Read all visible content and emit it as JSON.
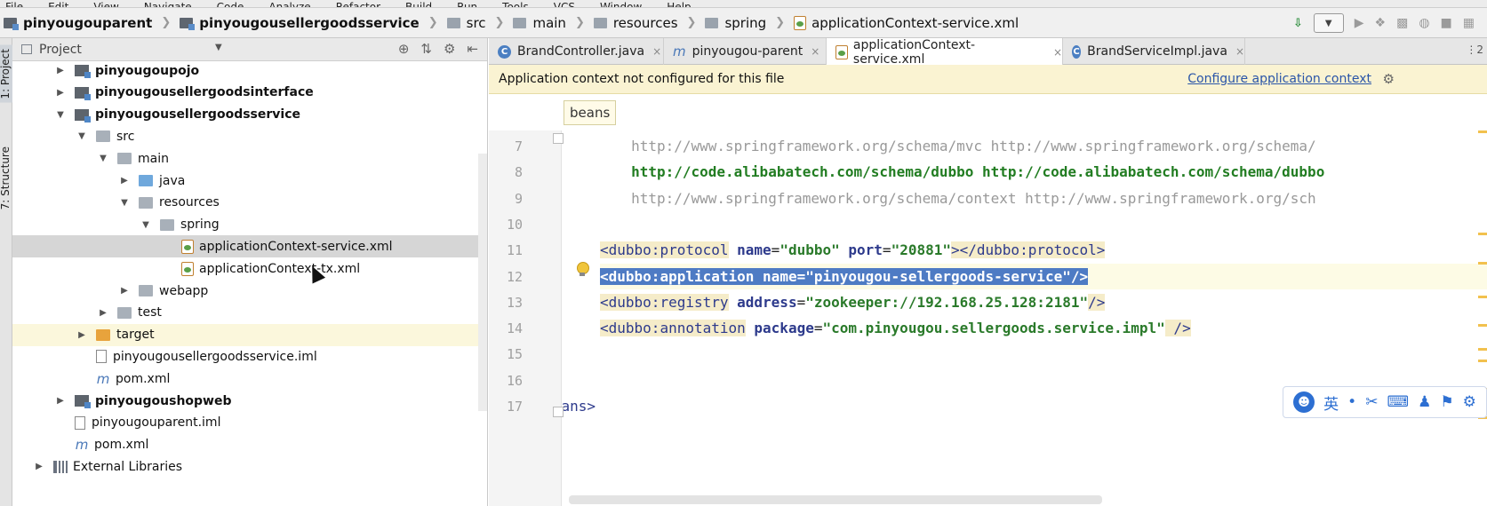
{
  "menubar": [
    "File",
    "Edit",
    "View",
    "Navigate",
    "Code",
    "Analyze",
    "Refactor",
    "Build",
    "Run",
    "Tools",
    "VCS",
    "Window",
    "Help"
  ],
  "breadcrumb": [
    {
      "label": "pinyougouparent",
      "kind": "module",
      "bold": true
    },
    {
      "label": "pinyougousellergoodsservice",
      "kind": "module",
      "bold": true
    },
    {
      "label": "src",
      "kind": "folder",
      "bold": false
    },
    {
      "label": "main",
      "kind": "folder",
      "bold": false
    },
    {
      "label": "resources",
      "kind": "folder",
      "bold": false
    },
    {
      "label": "spring",
      "kind": "folder",
      "bold": false
    },
    {
      "label": "applicationContext-service.xml",
      "kind": "xml",
      "bold": false
    }
  ],
  "left_strip": {
    "project_tab": "1: Project",
    "structure_tab": "7: Structure"
  },
  "project_panel": {
    "title": "Project"
  },
  "tree": [
    {
      "label": "pinyougoupojo",
      "level": 1,
      "arrow": "▶",
      "icon": "module",
      "bold": true
    },
    {
      "label": "pinyougousellergoodsinterface",
      "level": 1,
      "arrow": "▶",
      "icon": "module",
      "bold": true
    },
    {
      "label": "pinyougousellergoodsservice",
      "level": 1,
      "arrow": "▼",
      "icon": "module",
      "bold": true
    },
    {
      "label": "src",
      "level": 2,
      "arrow": "▼",
      "icon": "folder",
      "bold": false
    },
    {
      "label": "main",
      "level": 3,
      "arrow": "▼",
      "icon": "folder",
      "bold": false
    },
    {
      "label": "java",
      "level": 4,
      "arrow": "▶",
      "icon": "folder-blue",
      "bold": false
    },
    {
      "label": "resources",
      "level": 4,
      "arrow": "▼",
      "icon": "folder",
      "bold": false
    },
    {
      "label": "spring",
      "level": 5,
      "arrow": "▼",
      "icon": "folder",
      "bold": false
    },
    {
      "label": "applicationContext-service.xml",
      "level": 6,
      "arrow": "",
      "icon": "xml",
      "bold": false,
      "selected": true
    },
    {
      "label": "applicationContext-tx.xml",
      "level": 6,
      "arrow": "",
      "icon": "xml",
      "bold": false
    },
    {
      "label": "webapp",
      "level": 4,
      "arrow": "▶",
      "icon": "folder",
      "bold": false
    },
    {
      "label": "test",
      "level": 3,
      "arrow": "▶",
      "icon": "folder",
      "bold": false
    },
    {
      "label": "target",
      "level": 2,
      "arrow": "▶",
      "icon": "folder-orange",
      "bold": false,
      "excluded": true
    },
    {
      "label": "pinyougousellergoodsservice.iml",
      "level": 2,
      "arrow": "",
      "icon": "file",
      "bold": false
    },
    {
      "label": "pom.xml",
      "level": 2,
      "arrow": "",
      "icon": "maven",
      "bold": false
    },
    {
      "label": "pinyougoushopweb",
      "level": 1,
      "arrow": "▶",
      "icon": "module",
      "bold": true
    },
    {
      "label": "pinyougouparent.iml",
      "level": 1,
      "arrow": "",
      "icon": "file",
      "bold": false
    },
    {
      "label": "pom.xml",
      "level": 1,
      "arrow": "",
      "icon": "maven",
      "bold": false
    },
    {
      "label": "External Libraries",
      "level": 0,
      "arrow": "▶",
      "icon": "lib",
      "bold": false
    }
  ],
  "tabs": [
    {
      "label": "BrandController.java",
      "icon": "class",
      "active": false
    },
    {
      "label": "pinyougou-parent",
      "icon": "maven",
      "active": false
    },
    {
      "label": "applicationContext-service.xml",
      "icon": "xml",
      "active": true
    },
    {
      "label": "BrandServiceImpl.java",
      "icon": "class",
      "active": false
    }
  ],
  "tab_overflow": "⋮2",
  "banner": {
    "message": "Application context not configured for this file",
    "action": "Configure application context"
  },
  "breadcrumb_tag": "beans",
  "code_lines": [
    {
      "num": "7",
      "kind": "url",
      "text": "        http://www.springframework.org/schema/mvc http://www.springframework.org/schema/"
    },
    {
      "num": "8",
      "kind": "url-green",
      "text": "        http://code.alibabatech.com/schema/dubbo http://code.alibabatech.com/schema/dubbo"
    },
    {
      "num": "9",
      "kind": "url",
      "text": "        http://www.springframework.org/schema/context http://www.springframework.org/sch"
    },
    {
      "num": "10",
      "kind": "blank",
      "text": ""
    },
    {
      "num": "11",
      "kind": "tag",
      "tag": "dubbo:protocol",
      "attrs": [
        {
          "n": "name",
          "v": "\"dubbo\""
        },
        {
          "n": "port",
          "v": "\"20881\""
        }
      ],
      "close": "></dubbo:protocol>"
    },
    {
      "num": "12",
      "kind": "tag-selected",
      "tag": "dubbo:application",
      "attrs": [
        {
          "n": "name",
          "v": "\"pinyougou-sellergoods-service\""
        }
      ],
      "close": "/>"
    },
    {
      "num": "13",
      "kind": "tag",
      "tag": "dubbo:registry",
      "attrs": [
        {
          "n": "address",
          "v": "\"zookeeper://192.168.25.128:2181\""
        }
      ],
      "close": "/>"
    },
    {
      "num": "14",
      "kind": "tag",
      "tag": "dubbo:annotation",
      "attrs": [
        {
          "n": "package",
          "v": "\"com.pinyougou.sellergoods.service.impl\""
        }
      ],
      "close": " />"
    },
    {
      "num": "15",
      "kind": "blank",
      "text": ""
    },
    {
      "num": "16",
      "kind": "blank",
      "text": ""
    },
    {
      "num": "17",
      "kind": "end",
      "text": "</beans>"
    }
  ],
  "ime_toolbar": {
    "mode": "英",
    "items": [
      "•",
      "✂",
      "⌨",
      "♟",
      "⚑",
      "⚙"
    ]
  },
  "colors": {
    "selection": "#4e7bc4",
    "banner": "#faf3d2",
    "link": "#2a55a8",
    "tag": "#2d3a8c",
    "value": "#2a7a2a"
  }
}
